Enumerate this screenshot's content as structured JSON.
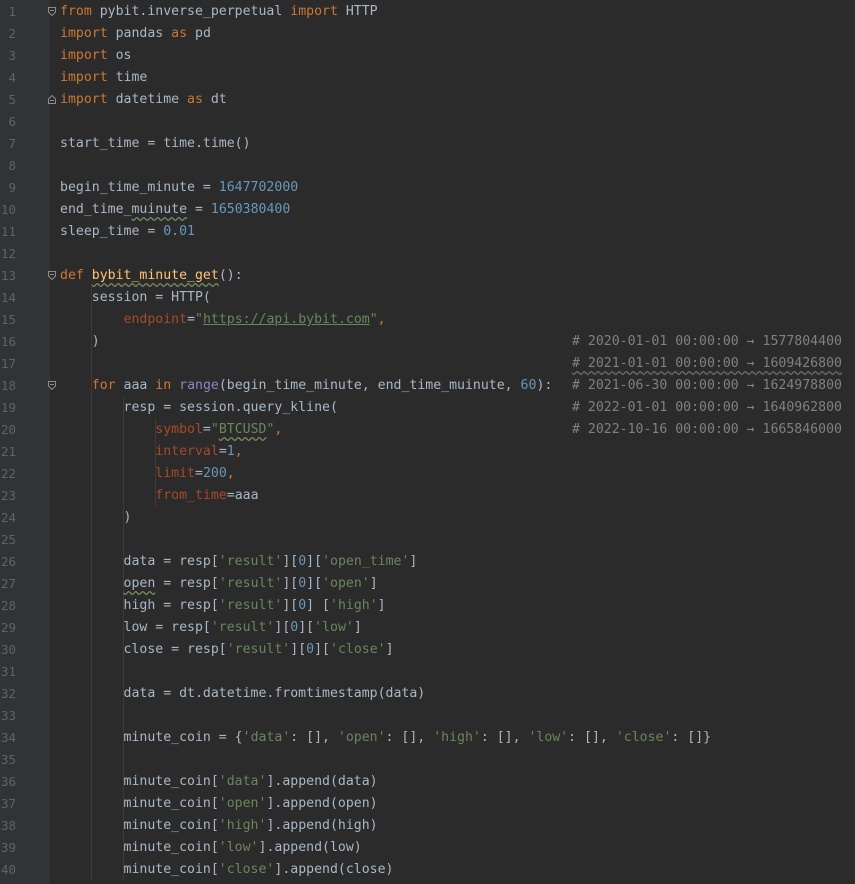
{
  "editor": {
    "lines": [
      {
        "n": "1",
        "code": [
          {
            "t": "from",
            "c": "kw"
          },
          {
            "t": " pybit.inverse_perpetual "
          },
          {
            "t": "import",
            "c": "kw"
          },
          {
            "t": " HTTP"
          }
        ],
        "fold": "open"
      },
      {
        "n": "2",
        "code": [
          {
            "t": "import",
            "c": "kw"
          },
          {
            "t": " pandas "
          },
          {
            "t": "as",
            "c": "kw"
          },
          {
            "t": " pd"
          }
        ]
      },
      {
        "n": "3",
        "code": [
          {
            "t": "import",
            "c": "kw"
          },
          {
            "t": " os"
          }
        ]
      },
      {
        "n": "4",
        "code": [
          {
            "t": "import",
            "c": "kw"
          },
          {
            "t": " time"
          }
        ]
      },
      {
        "n": "5",
        "code": [
          {
            "t": "import",
            "c": "kw"
          },
          {
            "t": " datetime "
          },
          {
            "t": "as",
            "c": "kw"
          },
          {
            "t": " dt"
          }
        ],
        "fold": "close"
      },
      {
        "n": "6",
        "code": []
      },
      {
        "n": "7",
        "code": [
          {
            "t": "start_time = time.time()"
          }
        ]
      },
      {
        "n": "8",
        "code": []
      },
      {
        "n": "9",
        "code": [
          {
            "t": "begin_time_minute = "
          },
          {
            "t": "1647702000",
            "c": "num"
          }
        ]
      },
      {
        "n": "10",
        "code": [
          {
            "t": "end_time_"
          },
          {
            "t": "muinute",
            "c": "wavy"
          },
          {
            "t": " = "
          },
          {
            "t": "1650380400",
            "c": "num"
          }
        ]
      },
      {
        "n": "11",
        "code": [
          {
            "t": "sleep_time = "
          },
          {
            "t": "0.01",
            "c": "num"
          }
        ]
      },
      {
        "n": "12",
        "code": []
      },
      {
        "n": "13",
        "code": [
          {
            "t": "def",
            "c": "kw"
          },
          {
            "t": " "
          },
          {
            "t": "bybit_minute_get",
            "c": "fn wavy"
          },
          {
            "t": "():"
          }
        ],
        "fold": "open"
      },
      {
        "n": "14",
        "code": [
          {
            "t": "    session = HTTP("
          }
        ]
      },
      {
        "n": "15",
        "code": [
          {
            "t": "        "
          },
          {
            "t": "endpoint",
            "c": "param"
          },
          {
            "t": "="
          },
          {
            "t": "\"",
            "c": "str"
          },
          {
            "t": "https://api.bybit.com",
            "c": "str url"
          },
          {
            "t": "\"",
            "c": "str"
          },
          {
            "t": ",",
            "c": "kw"
          }
        ]
      },
      {
        "n": "16",
        "code": [
          {
            "t": "    )"
          }
        ],
        "comment": "# 2020-01-01 00:00:00 → 1577804400"
      },
      {
        "n": "17",
        "code": [],
        "comment": "# 2021-01-01 00:00:00 → 1609426800",
        "comment_wavy": true
      },
      {
        "n": "18",
        "code": [
          {
            "t": "    "
          },
          {
            "t": "for",
            "c": "kw"
          },
          {
            "t": " aaa "
          },
          {
            "t": "in",
            "c": "kw"
          },
          {
            "t": " "
          },
          {
            "t": "range",
            "c": "bi"
          },
          {
            "t": "(begin_time_minute, end_time_muinute, "
          },
          {
            "t": "60",
            "c": "num"
          },
          {
            "t": "):"
          }
        ],
        "fold": "open",
        "comment": "# 2021-06-30 00:00:00 → 1624978800"
      },
      {
        "n": "19",
        "code": [
          {
            "t": "        resp = session.query_kline("
          }
        ],
        "comment": "# 2022-01-01 00:00:00 → 1640962800"
      },
      {
        "n": "20",
        "code": [
          {
            "t": "            "
          },
          {
            "t": "symbol",
            "c": "param"
          },
          {
            "t": "="
          },
          {
            "t": "\"",
            "c": "str"
          },
          {
            "t": "BTCUSD",
            "c": "str wavy"
          },
          {
            "t": "\"",
            "c": "str"
          },
          {
            "t": ",",
            "c": "kw"
          }
        ],
        "comment": "# 2022-10-16 00:00:00 → 1665846000"
      },
      {
        "n": "21",
        "code": [
          {
            "t": "            "
          },
          {
            "t": "interval",
            "c": "param"
          },
          {
            "t": "="
          },
          {
            "t": "1",
            "c": "num"
          },
          {
            "t": ",",
            "c": "kw"
          }
        ]
      },
      {
        "n": "22",
        "code": [
          {
            "t": "            "
          },
          {
            "t": "limit",
            "c": "param"
          },
          {
            "t": "="
          },
          {
            "t": "200",
            "c": "num"
          },
          {
            "t": ",",
            "c": "kw"
          }
        ]
      },
      {
        "n": "23",
        "code": [
          {
            "t": "            "
          },
          {
            "t": "from_time",
            "c": "param"
          },
          {
            "t": "=aaa"
          }
        ]
      },
      {
        "n": "24",
        "code": [
          {
            "t": "        )"
          }
        ]
      },
      {
        "n": "25",
        "code": []
      },
      {
        "n": "26",
        "code": [
          {
            "t": "        data = resp["
          },
          {
            "t": "'result'",
            "c": "str"
          },
          {
            "t": "]["
          },
          {
            "t": "0",
            "c": "num"
          },
          {
            "t": "]["
          },
          {
            "t": "'open_time'",
            "c": "str"
          },
          {
            "t": "]"
          }
        ]
      },
      {
        "n": "27",
        "code": [
          {
            "t": "        "
          },
          {
            "t": "open",
            "c": "wavy"
          },
          {
            "t": " = resp["
          },
          {
            "t": "'result'",
            "c": "str"
          },
          {
            "t": "]["
          },
          {
            "t": "0",
            "c": "num"
          },
          {
            "t": "]["
          },
          {
            "t": "'open'",
            "c": "str"
          },
          {
            "t": "]"
          }
        ]
      },
      {
        "n": "28",
        "code": [
          {
            "t": "        high = resp["
          },
          {
            "t": "'result'",
            "c": "str"
          },
          {
            "t": "]["
          },
          {
            "t": "0",
            "c": "num"
          },
          {
            "t": "] ["
          },
          {
            "t": "'high'",
            "c": "str"
          },
          {
            "t": "]"
          }
        ]
      },
      {
        "n": "29",
        "code": [
          {
            "t": "        low = resp["
          },
          {
            "t": "'result'",
            "c": "str"
          },
          {
            "t": "]["
          },
          {
            "t": "0",
            "c": "num"
          },
          {
            "t": "]["
          },
          {
            "t": "'low'",
            "c": "str"
          },
          {
            "t": "]"
          }
        ]
      },
      {
        "n": "30",
        "code": [
          {
            "t": "        close = resp["
          },
          {
            "t": "'result'",
            "c": "str"
          },
          {
            "t": "]["
          },
          {
            "t": "0",
            "c": "num"
          },
          {
            "t": "]["
          },
          {
            "t": "'close'",
            "c": "str"
          },
          {
            "t": "]"
          }
        ]
      },
      {
        "n": "31",
        "code": []
      },
      {
        "n": "32",
        "code": [
          {
            "t": "        data = dt.datetime.fromtimestamp(data)"
          }
        ]
      },
      {
        "n": "33",
        "code": []
      },
      {
        "n": "34",
        "code": [
          {
            "t": "        minute_coin = {"
          },
          {
            "t": "'data'",
            "c": "str"
          },
          {
            "t": ": [], "
          },
          {
            "t": "'open'",
            "c": "str"
          },
          {
            "t": ": [], "
          },
          {
            "t": "'high'",
            "c": "str"
          },
          {
            "t": ": [], "
          },
          {
            "t": "'low'",
            "c": "str"
          },
          {
            "t": ": [], "
          },
          {
            "t": "'close'",
            "c": "str"
          },
          {
            "t": ": []}"
          }
        ]
      },
      {
        "n": "35",
        "code": []
      },
      {
        "n": "36",
        "code": [
          {
            "t": "        minute_coin["
          },
          {
            "t": "'data'",
            "c": "str"
          },
          {
            "t": "].append(data)"
          }
        ]
      },
      {
        "n": "37",
        "code": [
          {
            "t": "        minute_coin["
          },
          {
            "t": "'open'",
            "c": "str"
          },
          {
            "t": "].append(open)"
          }
        ]
      },
      {
        "n": "38",
        "code": [
          {
            "t": "        minute_coin["
          },
          {
            "t": "'high'",
            "c": "str"
          },
          {
            "t": "].append(high)"
          }
        ]
      },
      {
        "n": "39",
        "code": [
          {
            "t": "        minute_coin["
          },
          {
            "t": "'low'",
            "c": "str"
          },
          {
            "t": "].append(low)"
          }
        ]
      },
      {
        "n": "40",
        "code": [
          {
            "t": "        minute_coin["
          },
          {
            "t": "'close'",
            "c": "str"
          },
          {
            "t": "].append(close)"
          }
        ]
      }
    ]
  },
  "colors": {
    "background": "#2b2b2b",
    "gutter": "#313335",
    "keyword": "#cc7832",
    "function": "#ffc66d",
    "number": "#6897bb",
    "string": "#6a8759",
    "parameter": "#aa4926",
    "comment": "#808080",
    "text": "#a9b7c6"
  }
}
